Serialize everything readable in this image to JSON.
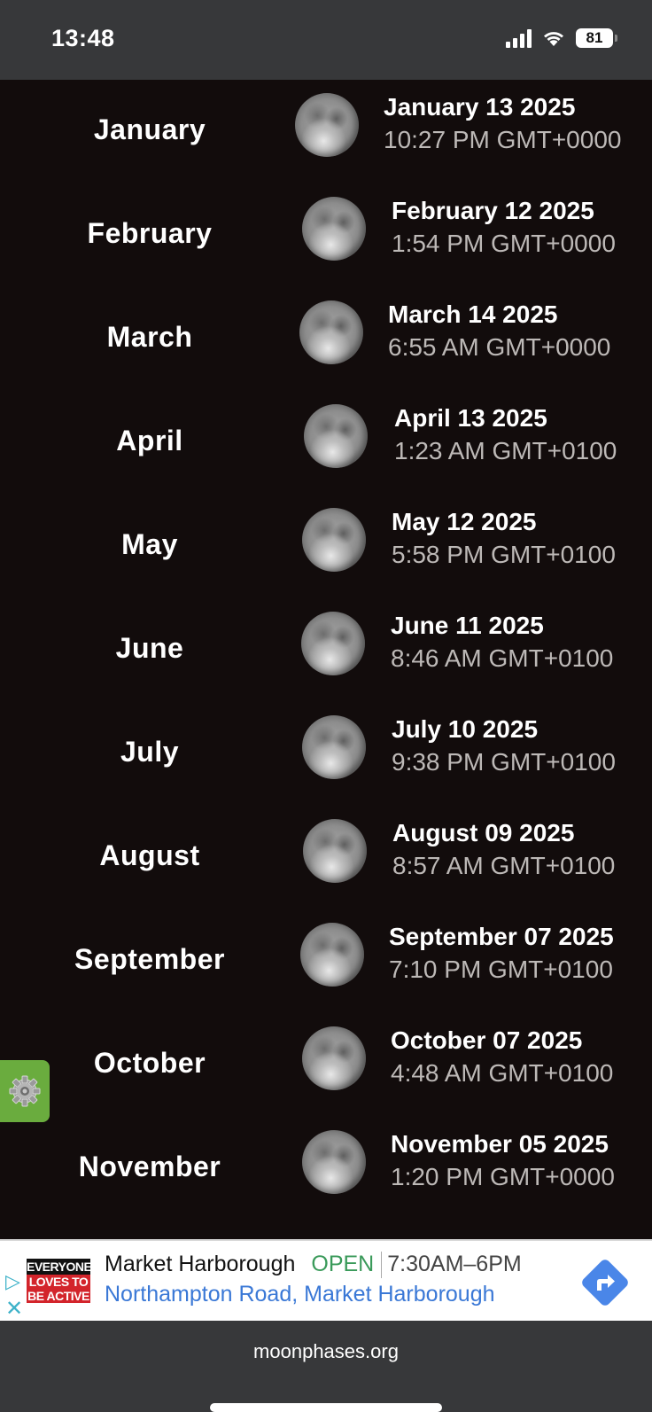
{
  "status_bar": {
    "time": "13:48",
    "battery": "81",
    "icons": [
      "signal-icon",
      "wifi-icon",
      "battery-icon"
    ]
  },
  "full_moons": [
    {
      "month": "January",
      "date": "January 13 2025",
      "time": "10:27 PM GMT+0000"
    },
    {
      "month": "February",
      "date": "February 12 2025",
      "time": "1:54 PM GMT+0000"
    },
    {
      "month": "March",
      "date": "March 14 2025",
      "time": "6:55 AM GMT+0000"
    },
    {
      "month": "April",
      "date": "April 13 2025",
      "time": "1:23 AM GMT+0100"
    },
    {
      "month": "May",
      "date": "May 12 2025",
      "time": "5:58 PM GMT+0100"
    },
    {
      "month": "June",
      "date": "June 11 2025",
      "time": "8:46 AM GMT+0100"
    },
    {
      "month": "July",
      "date": "July 10 2025",
      "time": "9:38 PM GMT+0100"
    },
    {
      "month": "August",
      "date": "August 09 2025",
      "time": "8:57 AM GMT+0100"
    },
    {
      "month": "September",
      "date": "September 07 2025",
      "time": "7:10 PM GMT+0100"
    },
    {
      "month": "October",
      "date": "October 07 2025",
      "time": "4:48 AM GMT+0100"
    },
    {
      "month": "November",
      "date": "November 05 2025",
      "time": "1:20 PM GMT+0000"
    }
  ],
  "settings_button": {
    "icon": "gear-icon",
    "color": "#6aac3e"
  },
  "ad": {
    "logo_line1": "EVERYONE",
    "logo_line2": "LOVES TO",
    "logo_line3": "BE ACTIVE",
    "title": "Market Harborough",
    "status": "OPEN",
    "hours": "7:30AM–6PM",
    "address": "Northampton Road, Market Harborough",
    "directions_icon": "directions-icon",
    "status_color": "#3a9a5a",
    "link_color": "#3a78d6"
  },
  "browser": {
    "url": "moonphases.org"
  }
}
